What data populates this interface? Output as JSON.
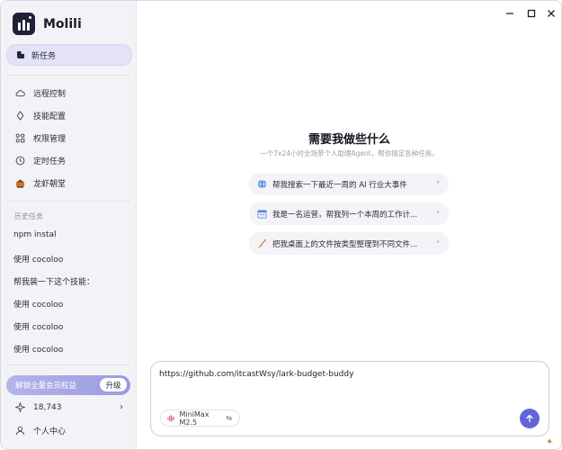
{
  "app": {
    "name": "Molili"
  },
  "sidebar": {
    "new_task": "新任务",
    "nav": [
      {
        "label": "远程控制",
        "icon": "cloud-icon"
      },
      {
        "label": "技能配置",
        "icon": "diamond-icon"
      },
      {
        "label": "权限管理",
        "icon": "grid-icon"
      },
      {
        "label": "定时任务",
        "icon": "clock-icon"
      },
      {
        "label": "龙虾朝堂",
        "icon": "lobster-hall-icon"
      }
    ],
    "history_title": "历史任务",
    "history": [
      "npm instal",
      "使用 cocoloo",
      "帮我装一下这个技能：",
      "使用 cocoloo",
      "使用 cocoloo",
      "使用 cocoloo"
    ],
    "upgrade": {
      "label": "解锁全量会员权益",
      "button": "升级"
    },
    "credits": "18,743",
    "profile": "个人中心"
  },
  "main": {
    "title": "需要我做些什么",
    "subtitle": "一个7x24小时全场景个人助理Agent，帮你搞定各种任务。",
    "suggestions": [
      {
        "label": "帮我搜索一下最近一周的 AI 行业大事件",
        "icon": "globe-icon"
      },
      {
        "label": "我是一名运营，帮我列一个本周的工作计...",
        "icon": "calendar-icon"
      },
      {
        "label": "把我桌面上的文件按类型整理到不同文件...",
        "icon": "broom-icon"
      }
    ]
  },
  "composer": {
    "text": "https://github.com/itcastWsy/lark-budget-buddy",
    "model": "MiniMax M2.5",
    "switch_glyph": "⇆"
  },
  "colors": {
    "accent": "#6563d8",
    "sidebar_bg": "#f3f3f7"
  }
}
